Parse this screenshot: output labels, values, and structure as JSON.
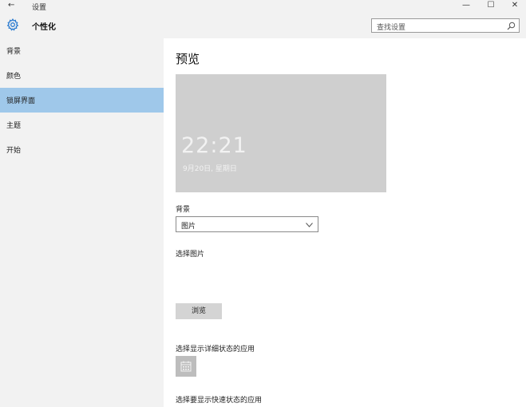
{
  "window": {
    "title": "设置",
    "back_glyph": "←",
    "minimize_glyph": "—",
    "maximize_glyph": "☐",
    "close_glyph": "✕"
  },
  "header": {
    "title": "个性化",
    "icon": "gear-icon",
    "search_placeholder": "查找设置",
    "search_icon": "search-icon"
  },
  "sidebar": {
    "items": [
      {
        "label": "背景",
        "active": false
      },
      {
        "label": "颜色",
        "active": false
      },
      {
        "label": "锁屏界面",
        "active": true
      },
      {
        "label": "主题",
        "active": false
      },
      {
        "label": "开始",
        "active": false
      }
    ]
  },
  "main": {
    "preview_heading": "预览",
    "preview_time": "22:21",
    "preview_date": "9月20日, 星期日",
    "background_label": "背景",
    "background_value": "图片",
    "choose_picture_label": "选择图片",
    "browse_label": "浏览",
    "detailed_status_label": "选择显示详细状态的应用",
    "quick_status_label": "选择要显示快速状态的应用",
    "detailed_app_icon": "calendar-icon"
  },
  "colors": {
    "accent": "#9fc8ea",
    "sidebar_bg": "#f2f2f2",
    "preview_bg": "#cfcfcf",
    "button_bg": "#d4d4d4"
  }
}
